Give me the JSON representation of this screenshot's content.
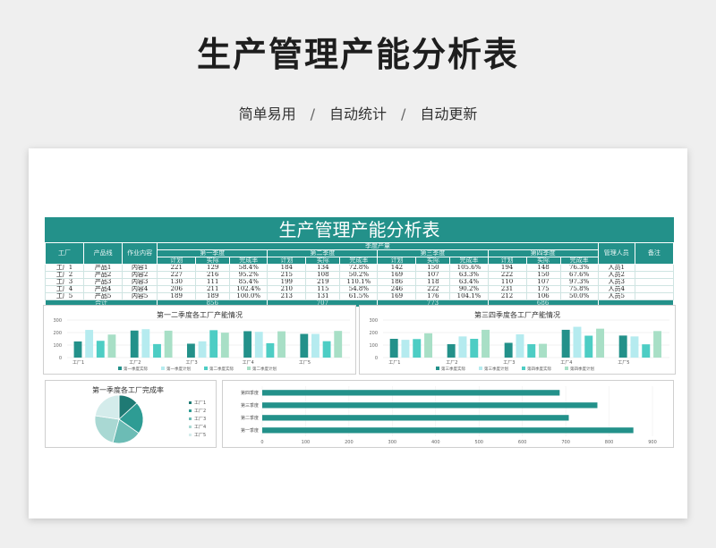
{
  "hero": {
    "title": "生产管理产能分析表",
    "features": [
      "简单易用",
      "自动统计",
      "自动更新"
    ],
    "separator": "/"
  },
  "sheet": {
    "title": "生产管理产能分析表",
    "headers": {
      "factory": "工厂",
      "product_line": "产品线",
      "work_content": "作业内容",
      "season_output": "季度产量",
      "quarters": [
        "第一季度",
        "第二季度",
        "第三季度",
        "第四季度"
      ],
      "sub": [
        "计划",
        "实际",
        "完成率"
      ],
      "manager": "管理人员",
      "note": "备注"
    },
    "rows": [
      {
        "factory": "工厂1",
        "line": "产品1",
        "content": "内容1",
        "q": [
          [
            "221",
            "129",
            "58.4%"
          ],
          [
            "184",
            "134",
            "72.8%"
          ],
          [
            "142",
            "150",
            "105.6%"
          ],
          [
            "194",
            "148",
            "76.3%"
          ]
        ],
        "manager": "人员1",
        "note": ""
      },
      {
        "factory": "工厂2",
        "line": "产品2",
        "content": "内容2",
        "q": [
          [
            "227",
            "216",
            "95.2%"
          ],
          [
            "215",
            "108",
            "50.2%"
          ],
          [
            "169",
            "107",
            "63.3%"
          ],
          [
            "222",
            "150",
            "67.6%"
          ]
        ],
        "manager": "人员2",
        "note": ""
      },
      {
        "factory": "工厂3",
        "line": "产品3",
        "content": "内容3",
        "q": [
          [
            "130",
            "111",
            "85.4%"
          ],
          [
            "199",
            "219",
            "110.1%"
          ],
          [
            "186",
            "118",
            "63.4%"
          ],
          [
            "110",
            "107",
            "97.3%"
          ]
        ],
        "manager": "人员3",
        "note": ""
      },
      {
        "factory": "工厂4",
        "line": "产品4",
        "content": "内容4",
        "q": [
          [
            "206",
            "211",
            "102.4%"
          ],
          [
            "210",
            "115",
            "54.8%"
          ],
          [
            "246",
            "222",
            "90.2%"
          ],
          [
            "231",
            "175",
            "75.8%"
          ]
        ],
        "manager": "人员4",
        "note": ""
      },
      {
        "factory": "工厂5",
        "line": "产品5",
        "content": "内容5",
        "q": [
          [
            "189",
            "189",
            "100.0%"
          ],
          [
            "213",
            "131",
            "61.5%"
          ],
          [
            "169",
            "176",
            "104.1%"
          ],
          [
            "212",
            "106",
            "50.0%"
          ]
        ],
        "manager": "人员5",
        "note": ""
      }
    ],
    "totals": {
      "label": "合计",
      "values": [
        "856",
        "707",
        "773",
        "686"
      ]
    }
  },
  "chart_data": [
    {
      "type": "bar",
      "title": "第一二季度各工厂产能情况",
      "categories": [
        "工厂1",
        "工厂2",
        "工厂3",
        "工厂4",
        "工厂5"
      ],
      "ylim": [
        0,
        300
      ],
      "yticks": [
        0,
        100,
        200,
        300
      ],
      "series": [
        {
          "name": "第一季度实际",
          "values": [
            129,
            216,
            111,
            211,
            189
          ],
          "color": "#23918a"
        },
        {
          "name": "第一季度计划",
          "values": [
            221,
            227,
            130,
            206,
            189
          ],
          "color": "#b5ebef"
        },
        {
          "name": "第二季度实际",
          "values": [
            134,
            108,
            219,
            115,
            131
          ],
          "color": "#4dcdc4"
        },
        {
          "name": "第二季度计划",
          "values": [
            184,
            215,
            199,
            210,
            213
          ],
          "color": "#a8dfc6"
        }
      ]
    },
    {
      "type": "bar",
      "title": "第三四季度各工厂产能情况",
      "categories": [
        "工厂1",
        "工厂2",
        "工厂3",
        "工厂4",
        "工厂5"
      ],
      "ylim": [
        0,
        300
      ],
      "yticks": [
        0,
        100,
        200,
        300
      ],
      "series": [
        {
          "name": "第三季度实际",
          "values": [
            150,
            107,
            118,
            222,
            176
          ],
          "color": "#23918a"
        },
        {
          "name": "第三季度计划",
          "values": [
            142,
            169,
            186,
            246,
            169
          ],
          "color": "#b5ebef"
        },
        {
          "name": "第四季度实际",
          "values": [
            148,
            150,
            107,
            175,
            106
          ],
          "color": "#4dcdc4"
        },
        {
          "name": "第四季度计划",
          "values": [
            194,
            222,
            110,
            231,
            212
          ],
          "color": "#a8dfc6"
        }
      ]
    },
    {
      "type": "pie",
      "title": "第一季度各工厂完成率",
      "categories": [
        "工厂1",
        "工厂2",
        "工厂3",
        "工厂4",
        "工厂5"
      ],
      "values": [
        58.4,
        95.2,
        85.4,
        102.4,
        100.0
      ],
      "colors": [
        "#1f7a74",
        "#2e9c94",
        "#6cbcb5",
        "#a9d8d3",
        "#d4eceb"
      ]
    },
    {
      "type": "bar",
      "orientation": "horizontal",
      "title": "各季度总产值",
      "categories": [
        "第四季度",
        "第三季度",
        "第二季度",
        "第一季度"
      ],
      "values": [
        686,
        773,
        707,
        856
      ],
      "xlim": [
        0,
        900
      ],
      "xticks": [
        0,
        100,
        200,
        300,
        400,
        500,
        600,
        700,
        800,
        900
      ],
      "color": "#23918a"
    }
  ]
}
